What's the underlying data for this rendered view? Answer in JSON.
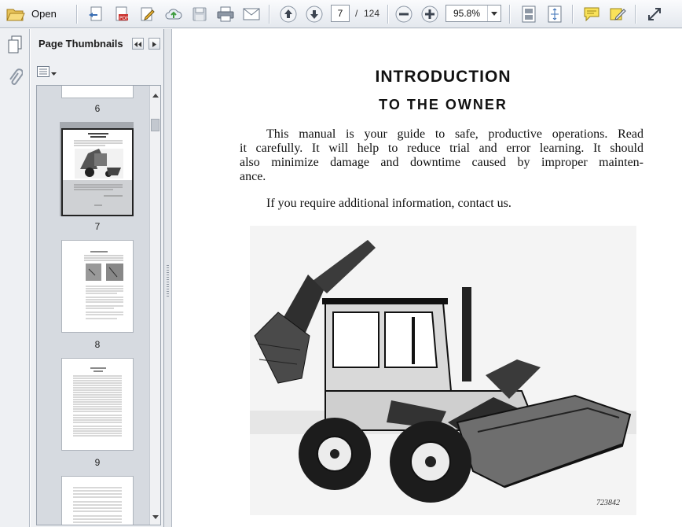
{
  "toolbar": {
    "open_label": "Open",
    "current_page": "7",
    "page_separator": "/",
    "total_pages": "124",
    "zoom": "95.8%"
  },
  "panel": {
    "title": "Page Thumbnails",
    "thumbnails": [
      {
        "label": "6"
      },
      {
        "label": "7",
        "selected": true
      },
      {
        "label": "8"
      },
      {
        "label": "9"
      }
    ]
  },
  "document": {
    "title": "INTRODUCTION",
    "subtitle": "TO THE OWNER",
    "paragraph1": [
      "This manual is your guide to safe, productive operations. Read",
      "it carefully. It will help to reduce trial and error learning. It should",
      "also minimize damage and downtime caused by improper mainten-",
      "ance."
    ],
    "paragraph2": "If you require additional information, contact us.",
    "photo_caption": "723842"
  },
  "colors": {
    "toolbar_bg": "#e4e8ee",
    "panel_bg": "#eef0f3",
    "selected_thumb": "#a5a9af",
    "icon_blue": "#3a6fb5"
  }
}
